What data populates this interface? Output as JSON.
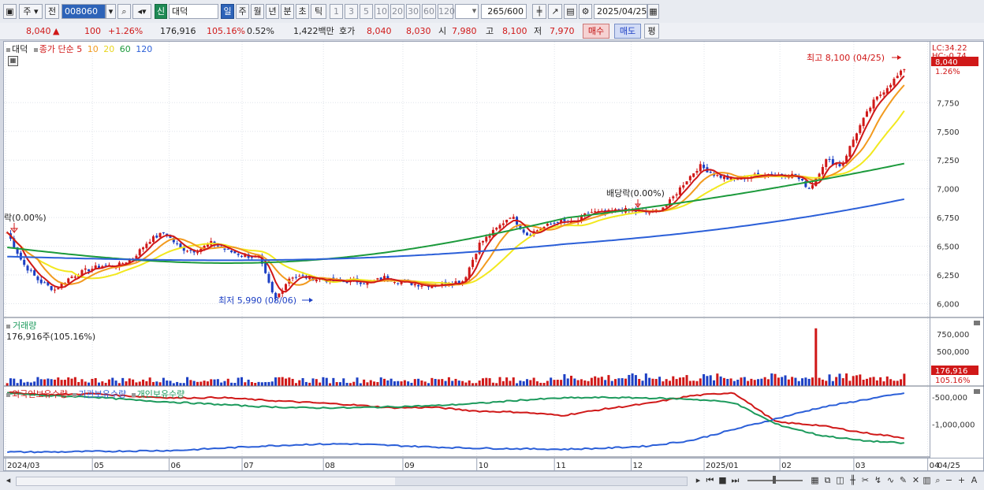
{
  "toolbar": {
    "type_label": "주",
    "market_label": "전",
    "code": "008060",
    "badge": "신",
    "stock_name": "대덕",
    "periods": [
      "일",
      "주",
      "월",
      "년",
      "분",
      "초",
      "틱"
    ],
    "active_period": "일",
    "intervals": [
      "1",
      "3",
      "5",
      "10",
      "20",
      "30",
      "60",
      "120"
    ],
    "count": "265",
    "count_total": "/600",
    "date": "2025/04/25"
  },
  "quote": {
    "price": "8,040",
    "change_arrow": "▲",
    "change": "100",
    "change_pct": "+1.26%",
    "volume": "176,916",
    "volume_ratio": "105.16%",
    "turnover": "0.52%",
    "amount": "1,422백만",
    "hoga_label": "호가",
    "ask": "8,040",
    "bid": "8,030",
    "open_label": "시",
    "open": "7,980",
    "high_label": "고",
    "high": "8,100",
    "low_label": "저",
    "low": "7,970",
    "buy_label": "매수",
    "sell_label": "매도",
    "flat_label": "평"
  },
  "price_panel": {
    "name": "대덕",
    "ma_label": "종가 단순",
    "ma_periods": [
      "5",
      "10",
      "20",
      "60",
      "120"
    ],
    "colors": {
      "up": "#d01818",
      "down": "#1c3fc4",
      "ma5": "#d01818",
      "ma10": "#f29a1e",
      "ma20": "#f2e81e",
      "ma60": "#1c9a3c",
      "ma120": "#2b5fd8"
    },
    "annot_high": "최고 8,100 (04/25)",
    "annot_low": "최저 5,990 (08/06)",
    "annot_div1": "배당락(0.00%)",
    "annot_div2": "락(0.00%)",
    "lc": "LC:34.22",
    "hc": "HC:-0.74",
    "price_tag": "8,040",
    "pct_tag": "1.26%"
  },
  "volume_panel": {
    "title": "거래량",
    "value": "176,916주(105.16%)",
    "tag": "176,916",
    "tag_pct": "105.16%"
  },
  "holding_panel": {
    "legend": [
      "외국인보유수량",
      "기관보유수량",
      "개인보유수량"
    ],
    "colors": [
      "#d01818",
      "#2b5fd8",
      "#1c9a5c"
    ]
  },
  "x_axis": [
    "2024/03",
    "05",
    "06",
    "07",
    "08",
    "09",
    "10",
    "11",
    "12",
    "2025/01",
    "02",
    "03",
    "04"
  ],
  "x_last": "04/25",
  "chart_data": [
    {
      "type": "candlestick",
      "title": "대덕",
      "y_ticks": [
        6000,
        6250,
        6500,
        6750,
        7000,
        7250,
        7500,
        7750
      ],
      "ylim": [
        5880,
        8280
      ],
      "high": 8100,
      "low": 5990,
      "last": 8040,
      "close_trend": [
        6620,
        6350,
        6200,
        6120,
        6230,
        6290,
        6330,
        6330,
        6400,
        6550,
        6620,
        6480,
        6460,
        6530,
        6460,
        6420,
        6400,
        6030,
        6240,
        6230,
        6210,
        6190,
        6200,
        6180,
        6230,
        6190,
        6170,
        6160,
        6180,
        6200,
        6520,
        6640,
        6770,
        6600,
        6660,
        6720,
        6700,
        6800,
        6790,
        6820,
        6800,
        6790,
        6870,
        7050,
        7200,
        7120,
        7080,
        7100,
        7130,
        7120,
        7120,
        7000,
        7250,
        7200,
        7500,
        7750,
        7900,
        8040
      ],
      "ma_values": {
        "ma60_start": 6490,
        "ma60_end": 7220,
        "ma120_start": 6410,
        "ma120_end": 6910
      }
    },
    {
      "type": "bar",
      "title": "거래량",
      "y_ticks": [
        500000,
        750000
      ],
      "last": 176916,
      "max": 850000
    },
    {
      "type": "line",
      "y_ticks": [
        -500000,
        -1000000
      ],
      "series": [
        {
          "name": "외국인보유수량",
          "values": [
            -420000,
            -460000,
            -440000,
            -490000,
            -520000,
            -510000,
            -560000,
            -600000,
            -640000,
            -700000,
            -690000,
            -760000,
            -780000,
            -840000,
            -720000,
            -620000,
            -480000,
            -420000,
            -960000,
            -1020000,
            -1150000,
            -1250000
          ]
        },
        {
          "name": "기관보유수량",
          "values": [
            -1510000,
            -1510000,
            -1500000,
            -1490000,
            -1480000,
            -1440000,
            -1400000,
            -1370000,
            -1360000,
            -1390000,
            -1420000,
            -1440000,
            -1450000,
            -1460000,
            -1440000,
            -1400000,
            -1300000,
            -1100000,
            -900000,
            -700000,
            -560000,
            -430000
          ]
        },
        {
          "name": "개인보유수량",
          "values": [
            -430000,
            -480000,
            -500000,
            -560000,
            -600000,
            -640000,
            -680000,
            -700000,
            -700000,
            -680000,
            -660000,
            -620000,
            -560000,
            -520000,
            -510000,
            -520000,
            -540000,
            -600000,
            -1000000,
            -1200000,
            -1300000,
            -1350000
          ]
        }
      ]
    }
  ]
}
